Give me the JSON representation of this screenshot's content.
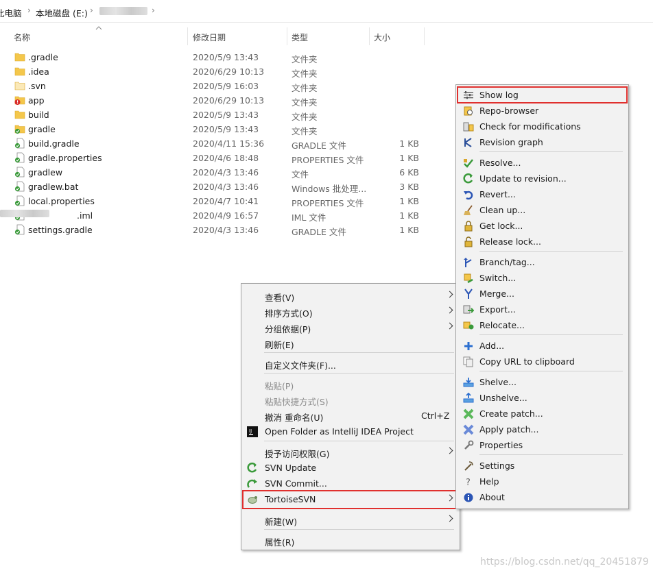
{
  "breadcrumb": {
    "items": [
      "此电脑",
      "本地磁盘 (E:)"
    ],
    "sep": "›"
  },
  "columns": {
    "name": "名称",
    "date": "修改日期",
    "type": "类型",
    "size": "大小"
  },
  "files": [
    {
      "name": ".gradle",
      "date": "2020/5/9 13:43",
      "type": "文件夹",
      "size": "",
      "icon": "folder-icon"
    },
    {
      "name": ".idea",
      "date": "2020/6/29 10:13",
      "type": "文件夹",
      "size": "",
      "icon": "folder-icon"
    },
    {
      "name": ".svn",
      "date": "2020/5/9 16:03",
      "type": "文件夹",
      "size": "",
      "icon": "folder-faded-icon"
    },
    {
      "name": "app",
      "date": "2020/6/29 10:13",
      "type": "文件夹",
      "size": "",
      "icon": "svn-modified-folder-icon"
    },
    {
      "name": "build",
      "date": "2020/5/9 13:43",
      "type": "文件夹",
      "size": "",
      "icon": "folder-icon"
    },
    {
      "name": "gradle",
      "date": "2020/5/9 13:43",
      "type": "文件夹",
      "size": "",
      "icon": "svn-normal-folder-icon"
    },
    {
      "name": "build.gradle",
      "date": "2020/4/11 15:36",
      "type": "GRADLE 文件",
      "size": "1 KB",
      "icon": "svn-normal-file-icon"
    },
    {
      "name": "gradle.properties",
      "date": "2020/4/6 18:48",
      "type": "PROPERTIES 文件",
      "size": "1 KB",
      "icon": "svn-normal-file-icon"
    },
    {
      "name": "gradlew",
      "date": "2020/4/3 13:46",
      "type": "文件",
      "size": "6 KB",
      "icon": "svn-normal-file-icon"
    },
    {
      "name": "gradlew.bat",
      "date": "2020/4/3 13:46",
      "type": "Windows 批处理...",
      "size": "3 KB",
      "icon": "svn-normal-file-icon"
    },
    {
      "name": "local.properties",
      "date": "2020/4/7 10:41",
      "type": "PROPERTIES 文件",
      "size": "1 KB",
      "icon": "svn-normal-file-icon"
    },
    {
      "name": ".iml",
      "date": "2020/4/9 16:57",
      "type": "IML 文件",
      "size": "1 KB",
      "icon": "svn-normal-file-icon"
    },
    {
      "name": "settings.gradle",
      "date": "2020/4/3 13:46",
      "type": "GRADLE 文件",
      "size": "1 KB",
      "icon": "svn-normal-file-icon"
    }
  ],
  "context_menu": {
    "items": [
      {
        "label": "查看(V)",
        "submenu": true
      },
      {
        "label": "排序方式(O)",
        "submenu": true
      },
      {
        "label": "分组依据(P)",
        "submenu": true
      },
      {
        "label": "刷新(E)"
      },
      {
        "label": "自定义文件夹(F)..."
      },
      {
        "label": "粘贴(P)",
        "disabled": true
      },
      {
        "label": "粘贴快捷方式(S)",
        "disabled": true
      },
      {
        "label": "撤消 重命名(U)",
        "accel": "Ctrl+Z"
      },
      {
        "label": "Open Folder as IntelliJ IDEA Project",
        "icon": "intellij-icon"
      },
      {
        "label": "授予访问权限(G)",
        "submenu": true
      },
      {
        "label": "SVN Update",
        "icon": "svn-update-icon"
      },
      {
        "label": "SVN Commit...",
        "icon": "svn-commit-icon"
      },
      {
        "label": "TortoiseSVN",
        "submenu": true,
        "icon": "tortoisesvn-icon"
      },
      {
        "label": "新建(W)",
        "submenu": true
      },
      {
        "label": "属性(R)"
      }
    ]
  },
  "svn_menu": {
    "items": [
      {
        "label": "Show log",
        "icon": "log-icon"
      },
      {
        "label": "Repo-browser",
        "icon": "repo-browser-icon"
      },
      {
        "label": "Check for modifications",
        "icon": "check-modifications-icon"
      },
      {
        "label": "Revision graph",
        "icon": "revision-graph-icon"
      },
      {
        "label": "Resolve...",
        "icon": "resolve-icon"
      },
      {
        "label": "Update to revision...",
        "icon": "update-revision-icon"
      },
      {
        "label": "Revert...",
        "icon": "revert-icon"
      },
      {
        "label": "Clean up...",
        "icon": "broom-icon"
      },
      {
        "label": "Get lock...",
        "icon": "lock-icon"
      },
      {
        "label": "Release lock...",
        "icon": "unlock-icon"
      },
      {
        "label": "Branch/tag...",
        "icon": "branch-icon"
      },
      {
        "label": "Switch...",
        "icon": "switch-icon"
      },
      {
        "label": "Merge...",
        "icon": "merge-icon"
      },
      {
        "label": "Export...",
        "icon": "export-icon"
      },
      {
        "label": "Relocate...",
        "icon": "relocate-icon"
      },
      {
        "label": "Add...",
        "icon": "plus-icon"
      },
      {
        "label": "Copy URL to clipboard",
        "icon": "copy-icon"
      },
      {
        "label": "Shelve...",
        "icon": "shelve-icon"
      },
      {
        "label": "Unshelve...",
        "icon": "unshelve-icon"
      },
      {
        "label": "Create patch...",
        "icon": "create-patch-icon"
      },
      {
        "label": "Apply patch...",
        "icon": "apply-patch-icon"
      },
      {
        "label": "Properties",
        "icon": "wrench-icon"
      },
      {
        "label": "Settings",
        "icon": "settings-icon"
      },
      {
        "label": "Help",
        "icon": "help-icon"
      },
      {
        "label": "About",
        "icon": "info-icon"
      }
    ]
  },
  "watermark": "https://blog.csdn.net/qq_20451879",
  "colors": {
    "highlight": "#e0302e",
    "folder": "#f4c74b",
    "svn_green": "#3a9a3a",
    "svn_red": "#d92b2b"
  }
}
